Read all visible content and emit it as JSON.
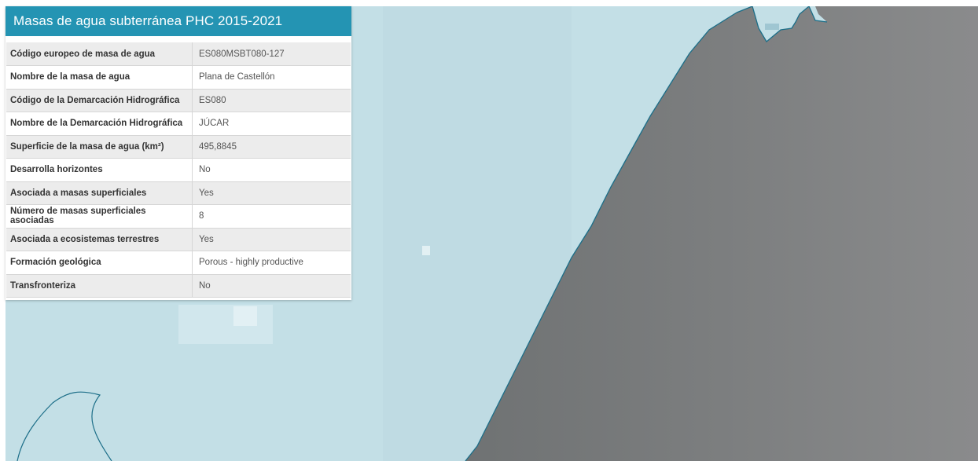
{
  "panel": {
    "title": "Masas de agua subterránea PHC 2015-2021",
    "rows": [
      {
        "key": "Código europeo de masa de agua",
        "value": "ES080MSBT080-127"
      },
      {
        "key": "Nombre de la masa de agua",
        "value": "Plana de Castellón"
      },
      {
        "key": "Código de la Demarcación Hidrográfica",
        "value": "ES080"
      },
      {
        "key": "Nombre de la Demarcación Hidrográfica",
        "value": "JÚCAR"
      },
      {
        "key": "Superficie de la masa de agua (km²)",
        "value": "495,8845"
      },
      {
        "key": "Desarrolla horizontes",
        "value": "No"
      },
      {
        "key": "Asociada a masas superficiales",
        "value": "Yes"
      },
      {
        "key": "Número de masas superficiales asociadas",
        "value": "8"
      },
      {
        "key": "Asociada a ecosistemas terrestres",
        "value": "Yes"
      },
      {
        "key": "Formación geológica",
        "value": "Porous - highly productive"
      },
      {
        "key": "Transfronteriza",
        "value": "No"
      }
    ]
  },
  "map": {
    "land_color": "#c3dfe6",
    "sea_color": "#7d7f80",
    "boundary_color": "#1c6e88"
  }
}
